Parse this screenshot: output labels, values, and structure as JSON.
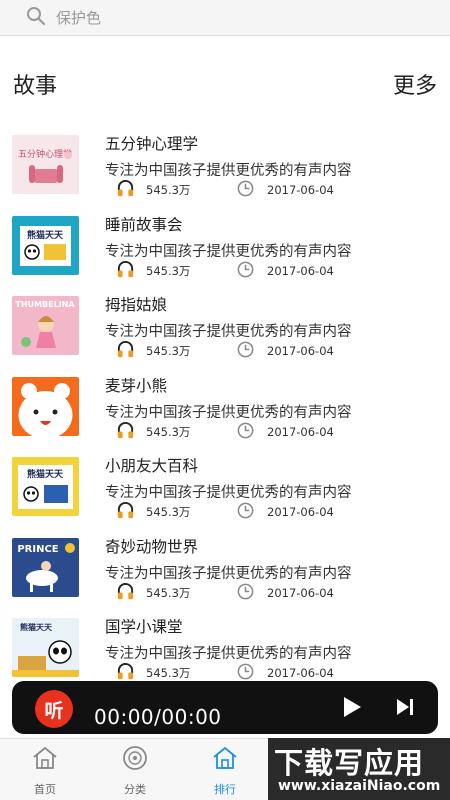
{
  "search": {
    "placeholder": "保护色",
    "icon": "search-icon"
  },
  "section": {
    "title": "故事",
    "more": "更多"
  },
  "items": [
    {
      "title": "五分钟心理学",
      "desc": "专注为中国孩子提供更优秀的有声内容",
      "plays": "545.3万",
      "date": "2017-06-04",
      "thumb_text": "五分钟心理学"
    },
    {
      "title": "睡前故事会",
      "desc": "专注为中国孩子提供更优秀的有声内容",
      "plays": "545.3万",
      "date": "2017-06-04",
      "thumb_text": "熊猫天天"
    },
    {
      "title": "拇指姑娘",
      "desc": "专注为中国孩子提供更优秀的有声内容",
      "plays": "545.3万",
      "date": "2017-06-04",
      "thumb_text": "THUMBELINA"
    },
    {
      "title": "麦芽小熊",
      "desc": "专注为中国孩子提供更优秀的有声内容",
      "plays": "545.3万",
      "date": "2017-06-04",
      "thumb_text": ""
    },
    {
      "title": "小朋友大百科",
      "desc": "专注为中国孩子提供更优秀的有声内容",
      "plays": "545.3万",
      "date": "2017-06-04",
      "thumb_text": "熊猫天天"
    },
    {
      "title": "奇妙动物世界",
      "desc": "专注为中国孩子提供更优秀的有声内容",
      "plays": "545.3万",
      "date": "2017-06-04",
      "thumb_text": "PRINCE"
    },
    {
      "title": "国学小课堂",
      "desc": "专注为中国孩子提供更优秀的有声内容",
      "plays": "545.3万",
      "date": "2017-06-04",
      "thumb_text": "熊猫天天"
    }
  ],
  "player": {
    "logo_text": "听",
    "time": "00:00/00:00"
  },
  "tabs": [
    {
      "label": "首页",
      "icon": "home-icon"
    },
    {
      "label": "分类",
      "icon": "disc-icon"
    },
    {
      "label": "排行",
      "icon": "home-icon"
    }
  ],
  "watermark": {
    "main": "下载写应用",
    "sub": "www.xiazaiNiao.com"
  },
  "colors": {
    "accent": "#1c8fe0",
    "player_bg": "#111111",
    "logo_red": "#e8321e",
    "meta_orange": "#f29a1f"
  }
}
